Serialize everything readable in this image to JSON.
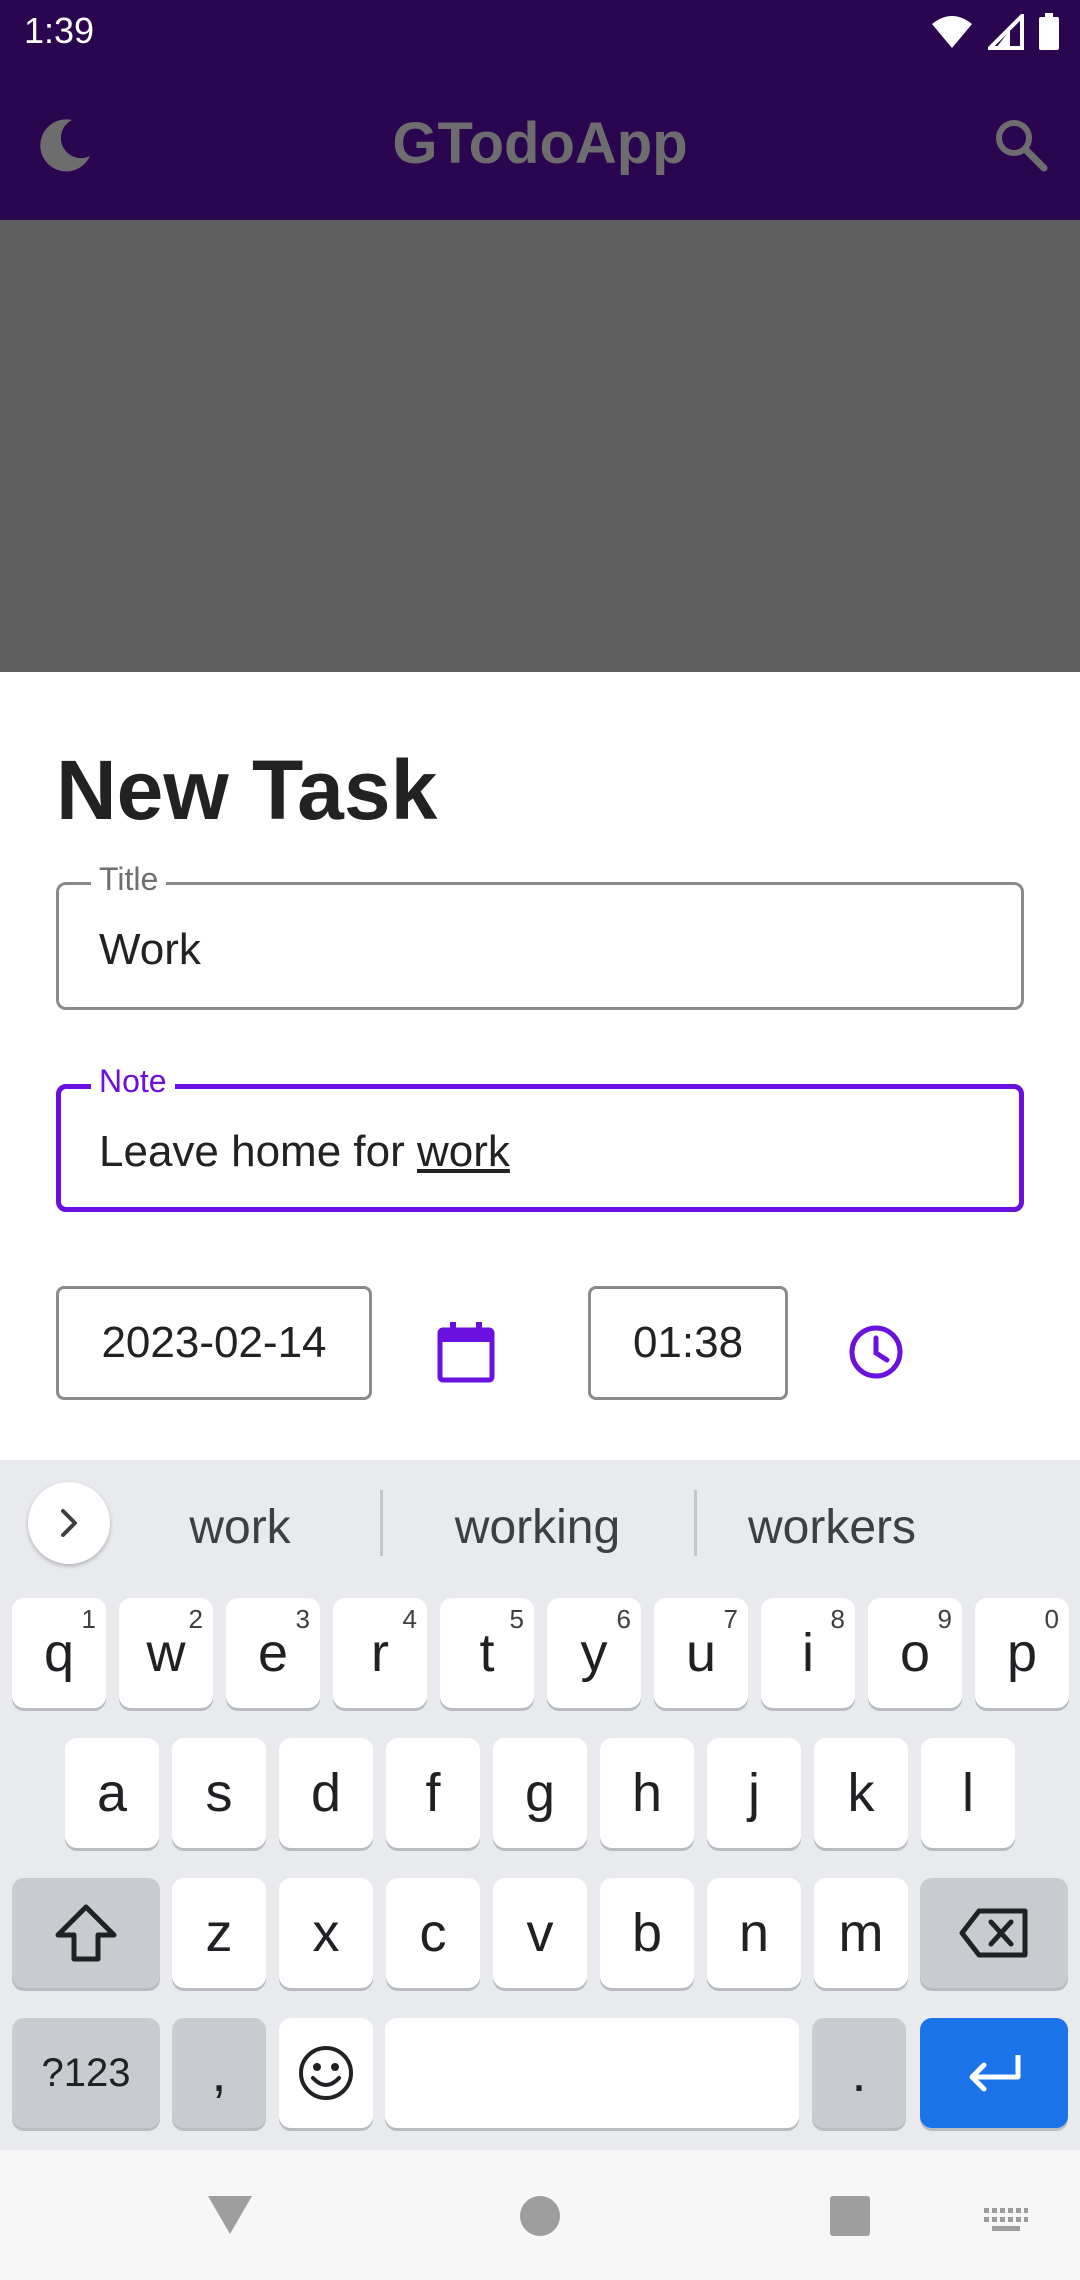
{
  "status_bar": {
    "time": "1:39"
  },
  "app_bar": {
    "title": "GTodoApp",
    "left_icon": "moon-icon",
    "right_icon": "search-icon"
  },
  "sheet": {
    "heading": "New Task",
    "title_field": {
      "label": "Title",
      "value": "Work"
    },
    "note_field": {
      "label": "Note",
      "value_prefix": "Leave home for ",
      "value_underlined": "work"
    },
    "date": "2023-02-14",
    "time": "01:38",
    "accent": "#6a10e0"
  },
  "keyboard": {
    "suggestions": [
      "work",
      "working",
      "workers"
    ],
    "row1": [
      {
        "k": "q",
        "h": "1"
      },
      {
        "k": "w",
        "h": "2"
      },
      {
        "k": "e",
        "h": "3"
      },
      {
        "k": "r",
        "h": "4"
      },
      {
        "k": "t",
        "h": "5"
      },
      {
        "k": "y",
        "h": "6"
      },
      {
        "k": "u",
        "h": "7"
      },
      {
        "k": "i",
        "h": "8"
      },
      {
        "k": "o",
        "h": "9"
      },
      {
        "k": "p",
        "h": "0"
      }
    ],
    "row2": [
      "a",
      "s",
      "d",
      "f",
      "g",
      "h",
      "j",
      "k",
      "l"
    ],
    "row3": [
      "z",
      "x",
      "c",
      "v",
      "b",
      "n",
      "m"
    ],
    "symbols_label": "?123",
    "comma": ",",
    "period": ".",
    "enter_color": "#1a73e8"
  }
}
